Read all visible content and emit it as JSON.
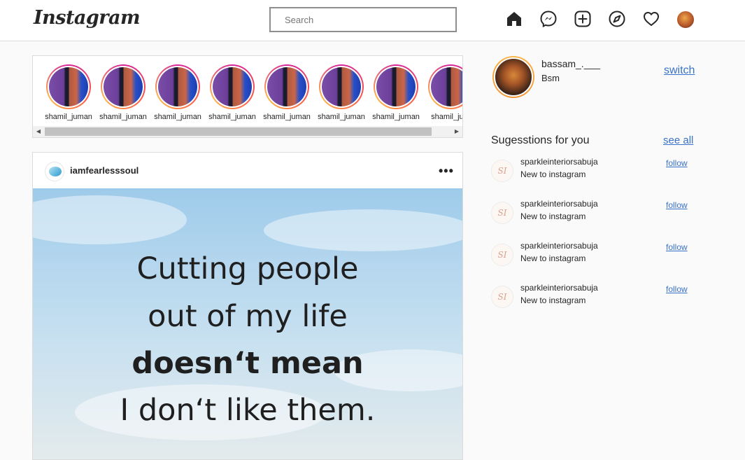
{
  "app": {
    "logo": "Instagram"
  },
  "header": {
    "search_placeholder": "Search",
    "icons": [
      "home-icon",
      "messenger-icon",
      "new-post-icon",
      "explore-icon",
      "activity-heart-icon",
      "profile-avatar-icon"
    ]
  },
  "stories": {
    "items": [
      {
        "name": "shamil_juman"
      },
      {
        "name": "shamil_juman"
      },
      {
        "name": "shamil_juman"
      },
      {
        "name": "shamil_juman"
      },
      {
        "name": "shamil_juman"
      },
      {
        "name": "shamil_juman"
      },
      {
        "name": "shamil_juman"
      },
      {
        "name": "shamil_jum"
      }
    ]
  },
  "post": {
    "username": "iamfearlesssoul",
    "more": "•••",
    "quote_lines": [
      "Cutting people",
      "out of my life",
      "doesn‘t mean",
      "I don‘t like them."
    ]
  },
  "profile": {
    "username": "bassam_.___",
    "name": "Bsm",
    "switch_label": "switch"
  },
  "suggestions": {
    "title": "Sugesstions for you",
    "see_all_label": "see all",
    "items": [
      {
        "avatar_text": "SI",
        "username": "sparkleinteriorsabuja",
        "subtitle": "New to instagram",
        "follow_label": "follow"
      },
      {
        "avatar_text": "SI",
        "username": "sparkleinteriorsabuja",
        "subtitle": "New to instagram",
        "follow_label": "follow"
      },
      {
        "avatar_text": "SI",
        "username": "sparkleinteriorsabuja",
        "subtitle": "New to instagram",
        "follow_label": "follow"
      },
      {
        "avatar_text": "SI",
        "username": "sparkleinteriorsabuja",
        "subtitle": "New to instagram",
        "follow_label": "follow"
      }
    ]
  },
  "colors": {
    "link": "#3972c8",
    "text": "#262626",
    "border": "#dbdbdb",
    "background": "#fafafa"
  }
}
